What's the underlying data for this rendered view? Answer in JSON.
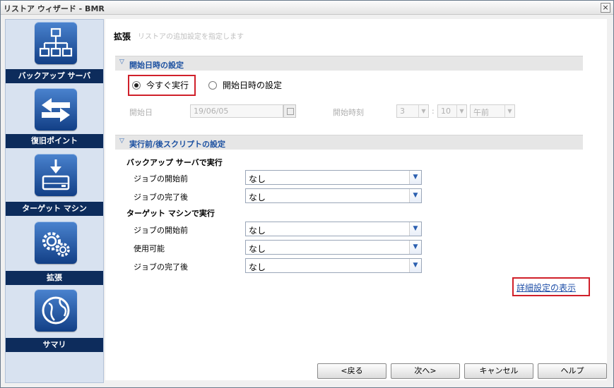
{
  "window": {
    "title": "リストア ウィザード - BMR",
    "close_glyph": "×"
  },
  "sidebar": {
    "items": [
      {
        "label": "バックアップ サーバ",
        "icon": "network-icon"
      },
      {
        "label": "復旧ポイント",
        "icon": "arrows-icon"
      },
      {
        "label": "ターゲット マシン",
        "icon": "drive-icon"
      },
      {
        "label": "拡張",
        "icon": "gears-icon"
      },
      {
        "label": "サマリ",
        "icon": "globe-icon"
      }
    ]
  },
  "page": {
    "title": "拡張",
    "subtitle": "リストアの追加設定を指定します"
  },
  "start_section": {
    "header": "開始日時の設定",
    "run_now_label": "今すぐ実行",
    "set_start_label": "開始日時の設定",
    "start_date_label": "開始日",
    "start_date_value": "19/06/05",
    "start_time_label": "開始時刻",
    "hour": "3",
    "minute": "10",
    "ampm": "午前",
    "colon": ":"
  },
  "script_section": {
    "header": "実行前/後スクリプトの設定",
    "server_group_title": "バックアップ サーバで実行",
    "target_group_title": "ターゲット マシンで実行",
    "rows": [
      {
        "label": "ジョブの開始前",
        "value": "なし"
      },
      {
        "label": "ジョブの完了後",
        "value": "なし"
      },
      {
        "label": "ジョブの開始前",
        "value": "なし"
      },
      {
        "label": "使用可能",
        "value": "なし"
      },
      {
        "label": "ジョブの完了後",
        "value": "なし"
      }
    ]
  },
  "advanced_link": "詳細設定の表示",
  "buttons": {
    "back": "<戻る",
    "next": "次へ>",
    "cancel": "キャンセル",
    "help": "ヘルプ"
  },
  "colors": {
    "nav_label_bg": "#0d2c5c",
    "section_text": "#1a4fa0",
    "highlight": "#d0202a"
  }
}
